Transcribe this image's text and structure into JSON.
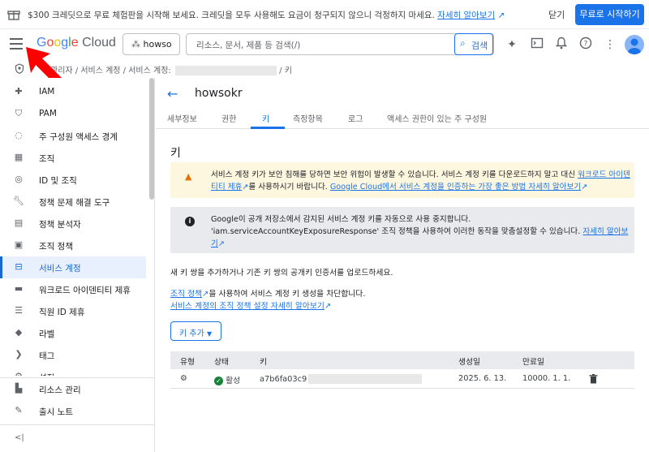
{
  "banner": {
    "message": "$300 크레딧으로 무료 체험판을 시작해 보세요. 크레딧을 모두 사용해도 요금이 청구되지 않으니 걱정하지 마세요.",
    "learn_more": "자세히 알아보기",
    "close": "닫기",
    "start": "무료로 시작하기"
  },
  "topbar": {
    "logo_google": "Google",
    "logo_cloud": "Cloud",
    "project": "howso",
    "search_placeholder": "리소스, 문서, 제품 등 검색(/)",
    "search_button": "검색"
  },
  "breadcrumb": {
    "text": "관리자 / 서비스 계정 / 서비스 계정:",
    "tail": "/ 키"
  },
  "sidebar": {
    "items": [
      {
        "label": "IAM",
        "icon": "person-add-icon"
      },
      {
        "label": "PAM",
        "icon": "shield-icon"
      },
      {
        "label": "주 구성원 액세스 경계",
        "icon": "boundary-icon"
      },
      {
        "label": "조직",
        "icon": "building-icon"
      },
      {
        "label": "ID 및 조직",
        "icon": "id-icon"
      },
      {
        "label": "정책 문제 해결 도구",
        "icon": "wrench-icon"
      },
      {
        "label": "정책 분석자",
        "icon": "doc-search-icon"
      },
      {
        "label": "조직 정책",
        "icon": "list-icon"
      },
      {
        "label": "서비스 계정",
        "icon": "service-account-icon"
      },
      {
        "label": "워크로드 아이덴티티 제휴",
        "icon": "workload-icon"
      },
      {
        "label": "직원 ID 제휴",
        "icon": "list-icon"
      },
      {
        "label": "라벨",
        "icon": "label-icon"
      },
      {
        "label": "태그",
        "icon": "tag-icon"
      },
      {
        "label": "설정",
        "icon": "gear-icon"
      }
    ],
    "bottom": [
      {
        "label": "리소스 관리",
        "icon": "folder-icon"
      },
      {
        "label": "출시 노트",
        "icon": "notes-icon"
      }
    ],
    "collapse": "<|"
  },
  "main": {
    "account_name": "howsokr",
    "tabs": [
      "세부정보",
      "권한",
      "키",
      "측정항목",
      "로그",
      "액세스 권한이 있는 주 구성원"
    ],
    "heading": "키",
    "warning_text": "서비스 계정 키가 보안 침해를 당하면 보안 위험이 발생할 수 있습니다. 서비스 계정 키를 다운로드하지 말고 대신 ",
    "warning_link1": "워크로드 아이덴티티 제휴",
    "warning_text2": "를 사용하시기 바랍니다. ",
    "warning_link2": "Google Cloud에서 서비스 계정을 인증하는 가장 좋은 방법 자세히 알아보기",
    "info_text": "Google이 공개 저장소에서 감지된 서비스 계정 키를 자동으로 사용 중지합니다. 'iam.serviceAccountKeyExposureResponse' 조직 정책을 사용하여 이러한 동작을 맞춤설정할 수 있습니다. ",
    "info_link": "자세히 알아보기",
    "add_pair_text": "새 키 쌍을 추가하거나 기존 키 쌍의 공개키 인증서를 업로드하세요.",
    "policy_link": "조직 정책",
    "policy_text": "을 사용하여 서비스 계정 키 생성을 차단합니다.",
    "policy_learn": "서비스 계정의 조직 정책 설정 자세히 알아보기",
    "add_key_button": "키 추가",
    "table": {
      "headers": [
        "유형",
        "상태",
        "키",
        "생성일",
        "만료일"
      ],
      "rows": [
        {
          "status": "활성",
          "key": "a7b6fa03c9",
          "created": "2025. 6. 13.",
          "expires": "10000. 1. 1."
        }
      ]
    }
  }
}
